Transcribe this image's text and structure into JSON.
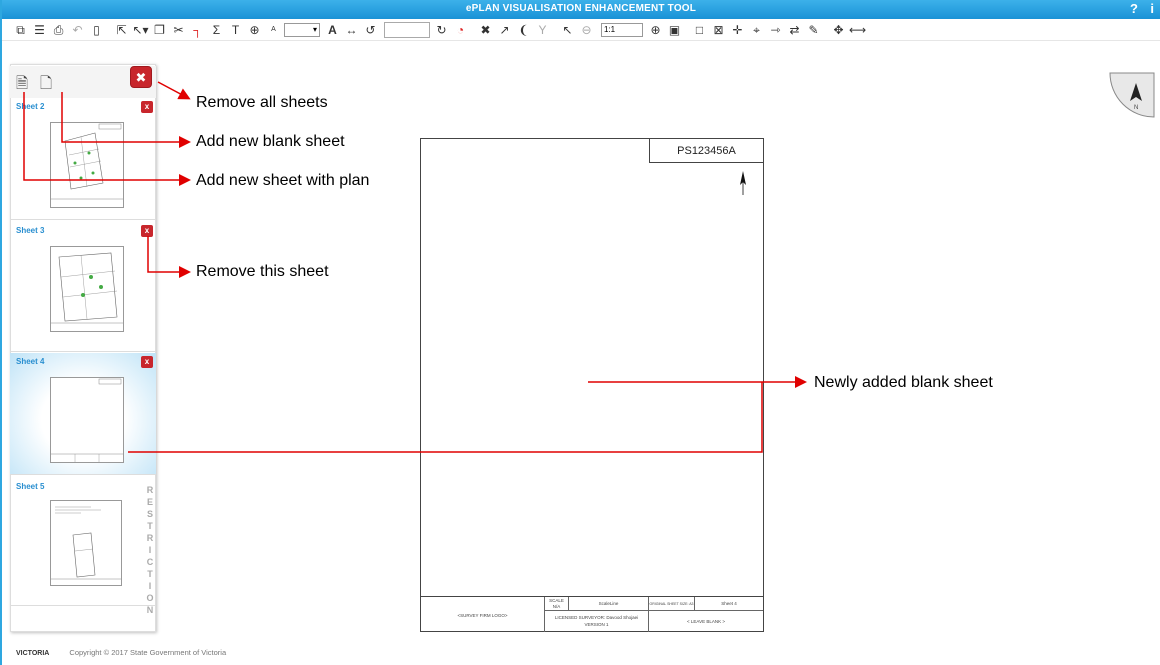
{
  "app": {
    "title": "ePLAN VISUALISATION ENHANCEMENT TOOL",
    "help": "?",
    "info": "i"
  },
  "toolbar": {
    "font_size_value": "▾",
    "scale_value": "1:1",
    "text_label": "T",
    "bold_a_label": "A",
    "small_a_label": "A"
  },
  "sheets": [
    {
      "label": "Sheet 2",
      "remove": "x"
    },
    {
      "label": "Sheet 3",
      "remove": "x"
    },
    {
      "label": "Sheet 4",
      "remove": "x"
    },
    {
      "label": "Sheet 5"
    }
  ],
  "restriction_letters": [
    "R",
    "E",
    "S",
    "T",
    "R",
    "I",
    "C",
    "T",
    "I",
    "O",
    "N"
  ],
  "annotations": {
    "remove_all": "Remove all sheets",
    "add_blank": "Add new blank sheet",
    "add_with_plan": "Add new sheet with plan",
    "remove_this": "Remove this sheet",
    "newly_added": "Newly added blank sheet"
  },
  "paper": {
    "plan_number": "PS123456A",
    "survey_logo": "<SURVEY FIRM LOGO>",
    "scale_label": "SCALE",
    "scale_value": "N/A",
    "scale_line": "ScaleLine",
    "original_sheet_size": "ORIGINAL SHEET SIZE: A3",
    "sheet_no": "Sheet 4",
    "surveyor": "LICENSED SURVEYOR: Davood Shojaei",
    "version": "VERSION 1",
    "leave_blank": "< LEAVE BLANK >"
  },
  "footer": {
    "logo": "VICTORIA",
    "copyright": "Copyright © 2017 State Government of Victoria"
  },
  "colors": {
    "accent": "#1a92d6",
    "remove": "#c8262c",
    "arrow": "#e00000"
  }
}
